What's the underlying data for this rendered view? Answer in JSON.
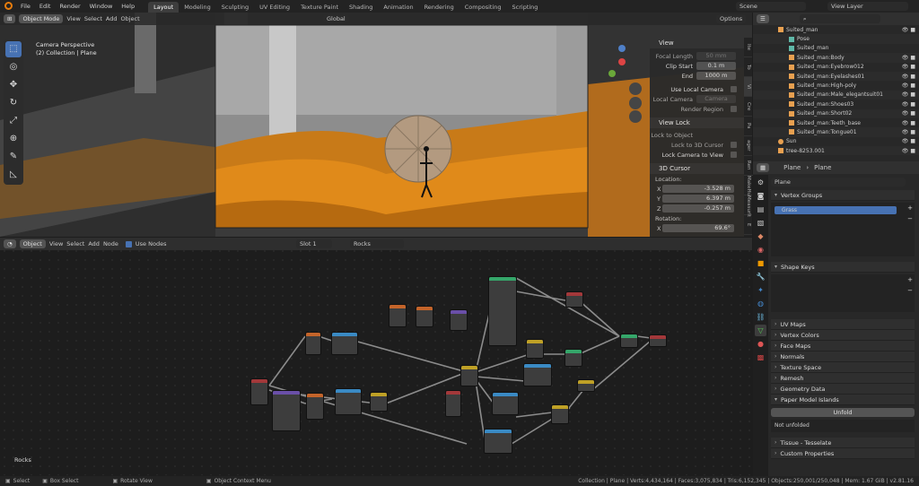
{
  "menus": [
    "File",
    "Edit",
    "Render",
    "Window",
    "Help"
  ],
  "workspaces": [
    "Layout",
    "Modeling",
    "Sculpting",
    "UV Editing",
    "Texture Paint",
    "Shading",
    "Animation",
    "Rendering",
    "Compositing",
    "Scripting"
  ],
  "top_right": {
    "scene_label": "Scene",
    "view_layer_label": "View Layer"
  },
  "viewport": {
    "mode": "Object Mode",
    "menu": [
      "View",
      "Select",
      "Add",
      "Object"
    ],
    "transform": "Global",
    "options": "Options",
    "overlay_title": "Camera Perspective",
    "overlay_sub": "(2) Collection | Plane"
  },
  "npanel": {
    "view_title": "View",
    "focal_label": "Focal Length",
    "focal_val": "50 mm",
    "clip_start_label": "Clip Start",
    "clip_start_val": "0.1 m",
    "end_label": "End",
    "end_val": "1000 m",
    "use_local_camera": "Use Local Camera",
    "local_camera_label": "Local Camera",
    "local_camera_val": "Camera",
    "render_region": "Render Region",
    "view_lock_title": "View Lock",
    "lock_object_label": "Lock to Object",
    "lock_3d_cursor": "Lock to 3D Cursor",
    "lock_camera": "Lock Camera to View",
    "cursor_title": "3D Cursor",
    "location_label": "Location:",
    "x_label": "X",
    "x_val": "-3.528 m",
    "y_label": "Y",
    "y_val": "6.397 m",
    "z_label": "Z",
    "z_val": "-0.257 m",
    "rotation_label": "Rotation:",
    "rx_val": "69.6°"
  },
  "vtabs": [
    "Ite",
    "To",
    "Vi",
    "Cre",
    "Pa",
    "ager",
    "MMMZ Ren",
    "MakeHu",
    "MeasurIt",
    "E"
  ],
  "nodes_header": {
    "type": "Object",
    "menu": [
      "View",
      "Select",
      "Add",
      "Node"
    ],
    "use_nodes": "Use Nodes",
    "slot": "Slot 1",
    "material": "Rocks"
  },
  "node_label": "Rocks",
  "outliner": {
    "rows": [
      {
        "name": "Suited_man",
        "color": "#e8a050",
        "vis": "👁 ■"
      },
      {
        "name": "Pose",
        "color": "#5fb8a8",
        "vis": ""
      },
      {
        "name": "Suited_man",
        "color": "#5fb8a8",
        "vis": ""
      },
      {
        "name": "Suited_man:Body",
        "color": "#e8a050",
        "vis": "👁 ■"
      },
      {
        "name": "Suited_man:Eyebrow012",
        "color": "#e8a050",
        "vis": "👁 ■"
      },
      {
        "name": "Suited_man:Eyelashes01",
        "color": "#e8a050",
        "vis": "👁 ■"
      },
      {
        "name": "Suited_man:High-poly",
        "color": "#e8a050",
        "vis": "👁 ■"
      },
      {
        "name": "Suited_man:Male_elegantsuit01",
        "color": "#e8a050",
        "vis": "👁 ■"
      },
      {
        "name": "Suited_man:Shoes03",
        "color": "#e8a050",
        "vis": "👁 ■"
      },
      {
        "name": "Suited_man:Short02",
        "color": "#e8a050",
        "vis": "👁 ■"
      },
      {
        "name": "Suited_man:Teeth_base",
        "color": "#e8a050",
        "vis": "👁 ■"
      },
      {
        "name": "Suited_man:Tongue01",
        "color": "#e8a050",
        "vis": "👁 ■"
      },
      {
        "name": "Sun",
        "color": "#e8a050",
        "vis": "👁 ■"
      },
      {
        "name": "tree-8253.001",
        "color": "#e8a050",
        "vis": "👁 ■"
      }
    ]
  },
  "props": {
    "breadcrumb_obj": "Plane",
    "breadcrumb_data": "Plane",
    "data_field": "Plane",
    "vertex_groups": "Vertex Groups",
    "vg_item": "Grass",
    "shape_keys": "Shape Keys",
    "sections": [
      "UV Maps",
      "Vertex Colors",
      "Face Maps",
      "Normals",
      "Texture Space",
      "Remesh",
      "Geometry Data"
    ],
    "paper_model": "Paper Model Islands",
    "unfold_btn": "Unfold",
    "not_unfolded": "Not unfolded",
    "tissue": "Tissue - Tesselate",
    "custom_props": "Custom Properties"
  },
  "status": {
    "select": "Select",
    "box_select": "Box Select",
    "rotate": "Rotate View",
    "context": "Object Context Menu",
    "stats": "Collection | Plane | Verts:4,434,164 | Faces:3,075,834 | Tris:6,152,345 | Objects:250,001/250,048 | Mem: 1.67 GiB | v2.81.16"
  }
}
